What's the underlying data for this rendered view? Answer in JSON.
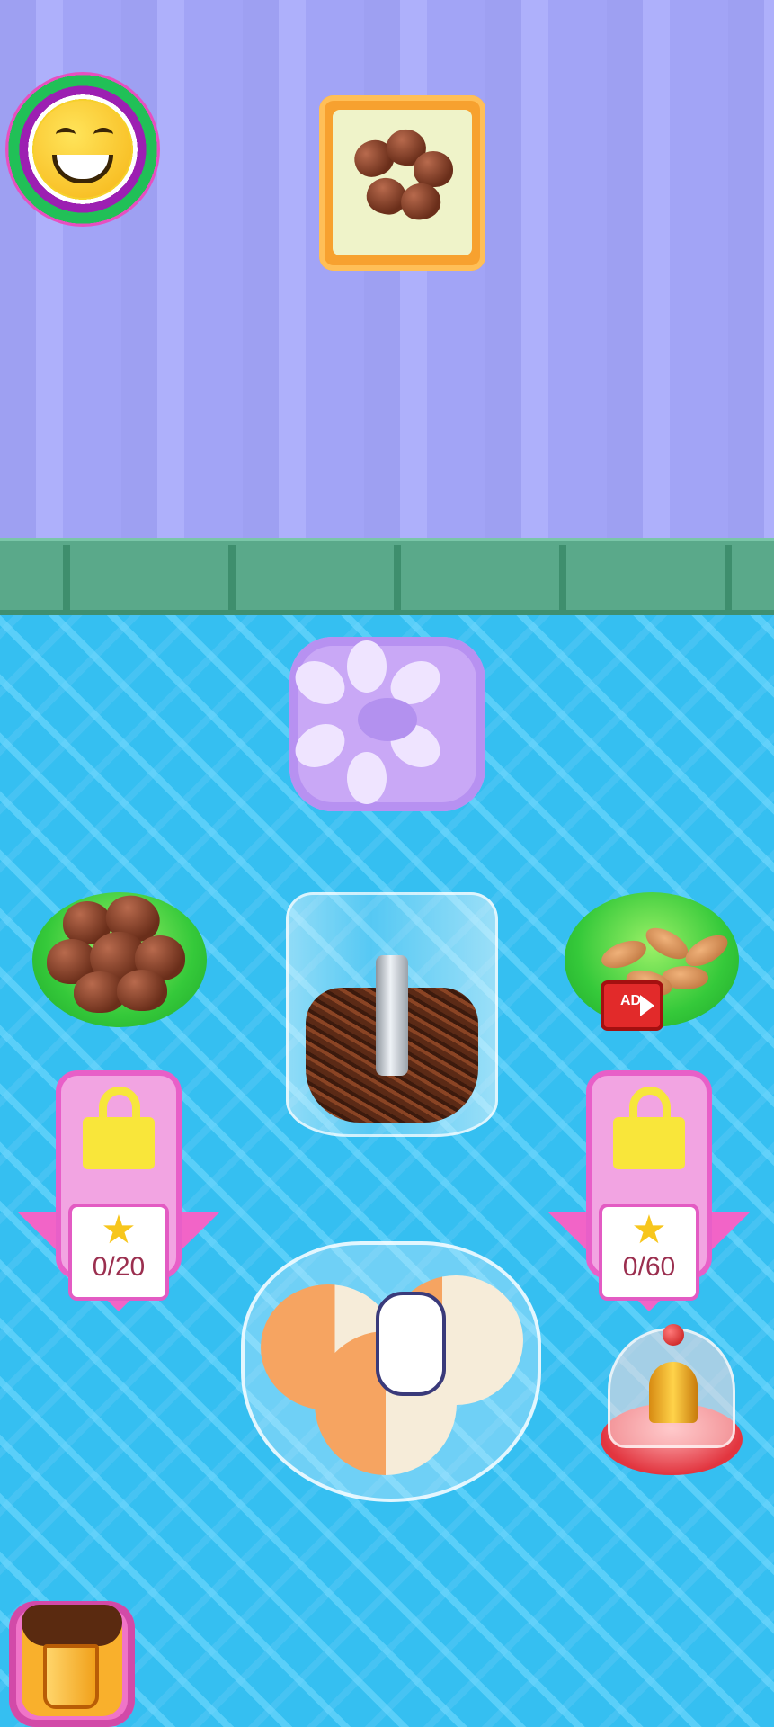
{
  "scene": "ice cream chef kitchen",
  "customer": {
    "mood_icon": "laughing-face-icon"
  },
  "order": {
    "icon": "chocolate-hearts-icon"
  },
  "toppings": {
    "left_bowl": {
      "icon": "chocolate-hearts-bowl-icon"
    },
    "right_bowl": {
      "icon": "almonds-bowl-icon",
      "ad_label": "AD"
    }
  },
  "locks": {
    "left": {
      "progress": "0/20",
      "star_icon": "star-icon"
    },
    "right": {
      "progress": "0/60",
      "star_icon": "star-icon"
    }
  },
  "tools": {
    "chopper_icon": "chocolate-chopper-icon",
    "mold_icon": "flower-mold-icon",
    "bell_icon": "service-bell-icon"
  },
  "dessert": {
    "icon": "ice-cream-bowl-icon",
    "hint_icon": "pointing-hand-icon"
  },
  "trash": {
    "icon": "trash-can-icon"
  },
  "colors": {
    "wall": "#a2a4f6",
    "rail": "#5aa98a",
    "floor": "#35bff1",
    "lock_pink": "#f2a4e2",
    "trash_pink": "#f074c8"
  }
}
